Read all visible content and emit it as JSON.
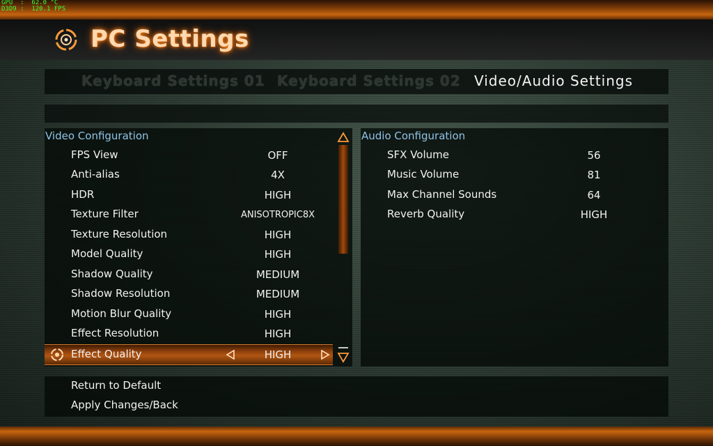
{
  "hud": {
    "line1": "GPU  :  62.0 °C",
    "line2": "D3D9 :  120.1 FPS"
  },
  "header": {
    "title": "PC Settings",
    "logo_icon": "target-ring-icon"
  },
  "tabs": [
    {
      "label": "Keyboard Settings 01",
      "active": false
    },
    {
      "label": "Keyboard Settings 02",
      "active": false
    },
    {
      "label": "Video/Audio Settings",
      "active": true
    }
  ],
  "video": {
    "title": "Video Configuration",
    "rows": [
      {
        "label": "FPS View",
        "value": "OFF"
      },
      {
        "label": "Anti-alias",
        "value": "4X"
      },
      {
        "label": "HDR",
        "value": "HIGH"
      },
      {
        "label": "Texture Filter",
        "value": "ANISOTROPIC8X"
      },
      {
        "label": "Texture Resolution",
        "value": "HIGH"
      },
      {
        "label": "Model Quality",
        "value": "HIGH"
      },
      {
        "label": "Shadow Quality",
        "value": "MEDIUM"
      },
      {
        "label": "Shadow Resolution",
        "value": "MEDIUM"
      },
      {
        "label": "Motion Blur Quality",
        "value": "HIGH"
      },
      {
        "label": "Effect Resolution",
        "value": "HIGH"
      },
      {
        "label": "Effect Quality",
        "value": "HIGH",
        "selected": true
      }
    ]
  },
  "audio": {
    "title": "Audio Configuration",
    "rows": [
      {
        "label": "SFX Volume",
        "value": "56"
      },
      {
        "label": "Music Volume",
        "value": "81"
      },
      {
        "label": "Max Channel Sounds",
        "value": "64"
      },
      {
        "label": "Reverb Quality",
        "value": "HIGH"
      }
    ]
  },
  "actions": {
    "return_default": "Return to Default",
    "apply_back": "Apply Changes/Back"
  },
  "colors": {
    "accent_orange": "#c8650f",
    "section_blue": "#8fc3e6",
    "hud_green": "#39ff39"
  }
}
